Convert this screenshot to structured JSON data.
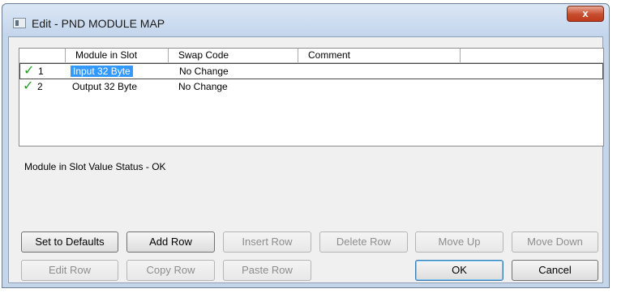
{
  "window": {
    "title": "Edit - PND MODULE MAP",
    "close_label": "x"
  },
  "grid": {
    "columns": [
      "",
      "Module in Slot",
      "Swap Code",
      "Comment",
      ""
    ],
    "rows": [
      {
        "index": "1",
        "status_icon": "checkmark-icon",
        "module": "Input 32 Byte",
        "swap_code": "No Change",
        "comment": "",
        "selected": true
      },
      {
        "index": "2",
        "status_icon": "checkmark-icon",
        "module": "Output 32 Byte",
        "swap_code": "No Change",
        "comment": "",
        "selected": false
      }
    ]
  },
  "status_text": "Module in Slot Value Status - OK",
  "buttons": {
    "set_defaults": "Set to Defaults",
    "add_row": "Add Row",
    "insert_row": "Insert Row",
    "delete_row": "Delete Row",
    "move_up": "Move Up",
    "move_down": "Move Down",
    "edit_row": "Edit Row",
    "copy_row": "Copy Row",
    "paste_row": "Paste Row",
    "ok": "OK",
    "cancel": "Cancel"
  },
  "colors": {
    "check": "#1f9d1f",
    "selection": "#3399ff",
    "close": "#c74d2e"
  }
}
